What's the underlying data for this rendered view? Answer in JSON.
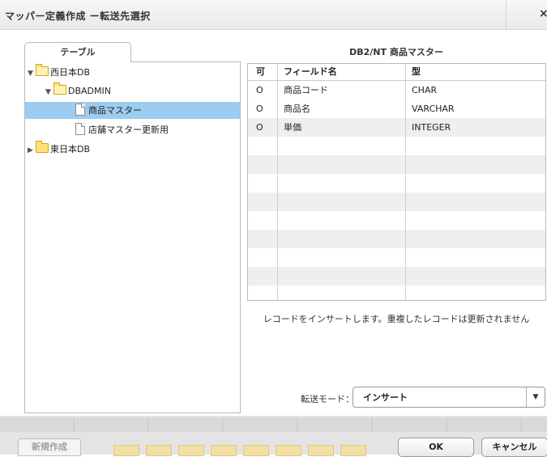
{
  "dialog": {
    "title": "マッパー定義作成 ー転送先選択",
    "close_glyph": "×"
  },
  "tree": {
    "tab_label": "テーブル",
    "items": [
      {
        "label": "西日本DB"
      },
      {
        "label": "DBADMIN"
      },
      {
        "label": "商品マスター"
      },
      {
        "label": "店舗マスター更新用"
      },
      {
        "label": "東日本DB"
      }
    ],
    "selected": "商品マスター"
  },
  "table": {
    "title": "DB2/NT 商品マスター",
    "headers": [
      "可",
      "フィールド名",
      "型"
    ],
    "rows": [
      {
        "flag": "O",
        "field": "商品コード",
        "type": "CHAR"
      },
      {
        "flag": "O",
        "field": "商品名",
        "type": "VARCHAR"
      },
      {
        "flag": "O",
        "field": "単価",
        "type": "INTEGER"
      }
    ]
  },
  "message": "レコードをインサートします。重複したレコードは更新されません",
  "mode": {
    "label": "転送モード：",
    "value": "インサート",
    "arrow": "▼"
  },
  "buttons": {
    "new": "新規作成",
    "ok": "OK",
    "cancel": "キャンセル"
  },
  "icons": {
    "expanded": "▼",
    "collapsed": "▶"
  }
}
